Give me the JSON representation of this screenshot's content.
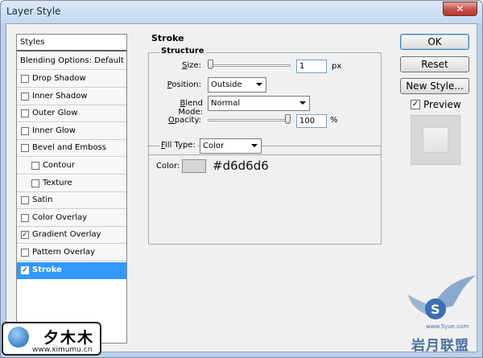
{
  "window": {
    "title": "Layer Style",
    "close_glyph": "✕"
  },
  "styles_panel": {
    "header": "Styles",
    "blending_options": "Blending Options: Default",
    "items": [
      {
        "label": "Drop Shadow",
        "checked": false,
        "indent": false,
        "selected": false
      },
      {
        "label": "Inner Shadow",
        "checked": false,
        "indent": false,
        "selected": false
      },
      {
        "label": "Outer Glow",
        "checked": false,
        "indent": false,
        "selected": false
      },
      {
        "label": "Inner Glow",
        "checked": false,
        "indent": false,
        "selected": false
      },
      {
        "label": "Bevel and Emboss",
        "checked": false,
        "indent": false,
        "selected": false
      },
      {
        "label": "Contour",
        "checked": false,
        "indent": true,
        "selected": false
      },
      {
        "label": "Texture",
        "checked": false,
        "indent": true,
        "selected": false
      },
      {
        "label": "Satin",
        "checked": false,
        "indent": false,
        "selected": false
      },
      {
        "label": "Color Overlay",
        "checked": false,
        "indent": false,
        "selected": false
      },
      {
        "label": "Gradient Overlay",
        "checked": true,
        "indent": false,
        "selected": false
      },
      {
        "label": "Pattern Overlay",
        "checked": false,
        "indent": false,
        "selected": false
      },
      {
        "label": "Stroke",
        "checked": true,
        "indent": false,
        "selected": true
      }
    ],
    "check_glyph": "✓"
  },
  "stroke": {
    "section_title": "Stroke",
    "structure_title": "Structure",
    "size": {
      "label": "Size:",
      "value": "1",
      "unit": "px",
      "slider_fraction": 0.0
    },
    "position": {
      "label": "Position:",
      "value": "Outside"
    },
    "blend_mode": {
      "label": "Blend Mode:",
      "value": "Normal"
    },
    "opacity": {
      "label": "Opacity:",
      "value": "100",
      "unit": "%",
      "slider_fraction": 1.0
    },
    "fill_type": {
      "label": "Fill Type:",
      "value": "Color"
    },
    "color": {
      "label": "Color:",
      "value": "#d6d6d6",
      "hex_text": "#d6d6d6"
    }
  },
  "buttons": {
    "ok": "OK",
    "reset": "Reset",
    "new_style": "New Style...",
    "preview_label": "Preview",
    "preview_checked": true
  },
  "watermarks": {
    "left_cn": "夕木木",
    "left_url": "www.ximumu.cn",
    "right_cn": "岩月联盟",
    "right_url": "www.5yue.com"
  },
  "colors": {
    "selection": "#3399ff",
    "dialog_bg": "#f0f0f0",
    "titlebar": "#c4d8ee",
    "stroke_color": "#d6d6d6"
  }
}
